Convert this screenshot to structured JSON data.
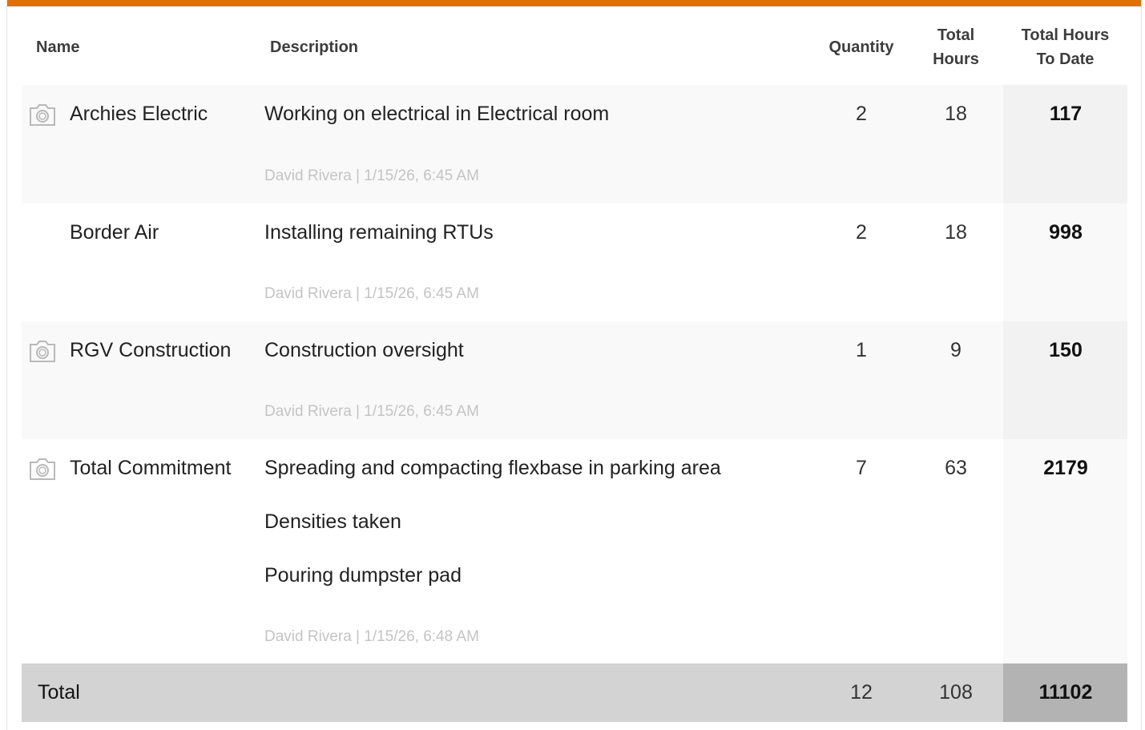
{
  "headers": {
    "name": "Name",
    "description": "Description",
    "quantity": "Quantity",
    "total_hours_line1": "Total",
    "total_hours_line2": "Hours",
    "to_date_line1": "Total Hours",
    "to_date_line2": "To Date"
  },
  "rows": [
    {
      "name": "Archies Electric",
      "has_photo": true,
      "descriptions": [
        "Working on electrical in Electrical room"
      ],
      "meta": "David Rivera | 1/15/26, 6:45 AM",
      "quantity": "2",
      "total_hours": "18",
      "to_date": "117"
    },
    {
      "name": "Border Air",
      "has_photo": false,
      "descriptions": [
        "Installing remaining RTUs"
      ],
      "meta": "David Rivera | 1/15/26, 6:45 AM",
      "quantity": "2",
      "total_hours": "18",
      "to_date": "998"
    },
    {
      "name": "RGV Construction",
      "has_photo": true,
      "descriptions": [
        "Construction oversight"
      ],
      "meta": "David Rivera | 1/15/26, 6:45 AM",
      "quantity": "1",
      "total_hours": "9",
      "to_date": "150"
    },
    {
      "name": "Total Commitment",
      "has_photo": true,
      "descriptions": [
        "Spreading and compacting flexbase in parking area",
        "Densities taken",
        "Pouring dumpster pad"
      ],
      "meta": "David Rivera | 1/15/26, 6:48 AM",
      "quantity": "7",
      "total_hours": "63",
      "to_date": "2179"
    }
  ],
  "total": {
    "label": "Total",
    "quantity": "12",
    "total_hours": "108",
    "to_date": "11102"
  },
  "colors": {
    "accent": "#e07000",
    "total_row": "#d3d3d3",
    "total_to_date": "#b3b3b3"
  },
  "icons": {
    "photo": "camera-icon"
  }
}
